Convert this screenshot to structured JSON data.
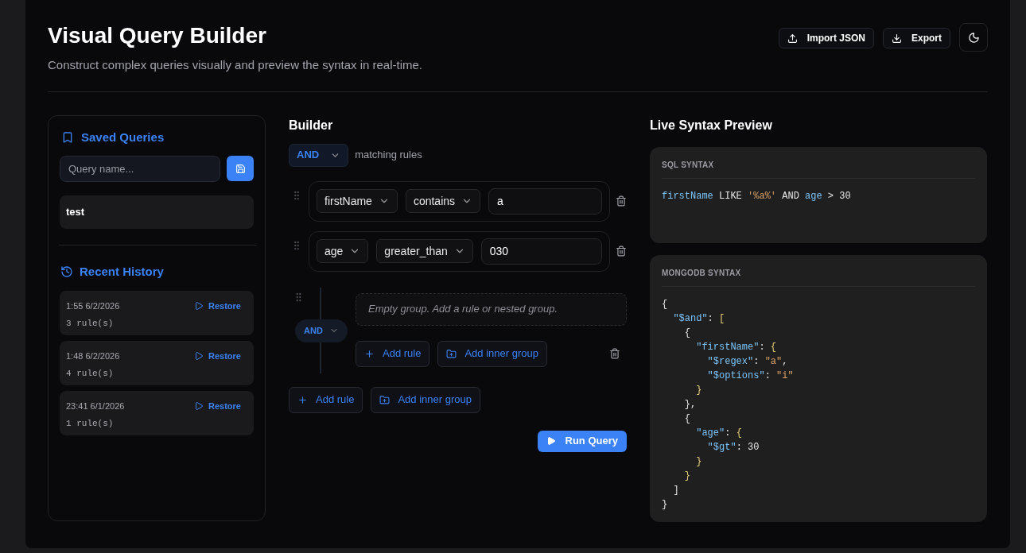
{
  "header": {
    "title": "Visual Query Builder",
    "subtitle": "Construct complex queries visually and preview the syntax in real-time.",
    "actions": [
      {
        "kind": "import",
        "label": "Import JSON"
      },
      {
        "kind": "export",
        "label": "Export"
      },
      {
        "kind": "theme"
      }
    ]
  },
  "sidebar": {
    "saved_title": "Saved Queries",
    "name_field": {
      "placeholder": "Query name..."
    },
    "saved": [
      {
        "name": "test"
      }
    ],
    "history_title": "Recent History",
    "history": [
      {
        "time": "1:55 6/2/2026",
        "rules": "3 rule(s)",
        "action": "Restore"
      },
      {
        "time": "1:48 6/2/2026",
        "rules": "4 rule(s)",
        "action": "Restore"
      },
      {
        "time": "23:41 6/1/2026",
        "rules": "1 rule(s)",
        "action": "Restore"
      }
    ]
  },
  "builder": {
    "title": "Builder",
    "combinator": "AND",
    "combinator_hint": "matching rules",
    "children": [
      {
        "kind": "rule",
        "field": "firstName",
        "operator": "contains",
        "value": "a"
      },
      {
        "kind": "rule",
        "field": "age",
        "operator": "greater_than",
        "value": "030"
      },
      {
        "kind": "group",
        "combinator": "AND",
        "empty_text": "Empty group. Add a rule or nested group.",
        "actions": [
          {
            "kind": "rule",
            "label": "Add rule"
          },
          {
            "kind": "group",
            "label": "Add inner group"
          }
        ]
      }
    ],
    "actions": [
      {
        "kind": "rule",
        "label": "Add rule"
      },
      {
        "kind": "group",
        "label": "Add inner group"
      }
    ],
    "run_label": "Run Query"
  },
  "preview": {
    "title": "Live Syntax Preview",
    "panels": [
      {
        "label": "SQL SYNTAX",
        "lines": [
          [
            {
              "kind": "field",
              "text": "firstName"
            },
            {
              "kind": "plain",
              "text": " LIKE "
            },
            {
              "kind": "string",
              "text": "'%a%'"
            },
            {
              "kind": "plain",
              "text": " AND "
            },
            {
              "kind": "field",
              "text": "age"
            },
            {
              "kind": "plain",
              "text": " > 30"
            }
          ]
        ]
      },
      {
        "label": "MONGODB SYNTAX",
        "lines": [
          [
            {
              "kind": "plain",
              "text": "{"
            }
          ],
          [
            {
              "kind": "field",
              "text": "  \"$and\""
            },
            {
              "kind": "plain",
              "text": ": "
            },
            {
              "kind": "bracket",
              "text": "["
            }
          ],
          [
            {
              "kind": "plain",
              "text": "    {"
            }
          ],
          [
            {
              "kind": "field",
              "text": "      \"firstName\""
            },
            {
              "kind": "plain",
              "text": ": "
            },
            {
              "kind": "bracket",
              "text": "{"
            }
          ],
          [
            {
              "kind": "field",
              "text": "        \"$regex\""
            },
            {
              "kind": "plain",
              "text": ": "
            },
            {
              "kind": "string",
              "text": "\"a\""
            },
            {
              "kind": "plain",
              "text": ","
            }
          ],
          [
            {
              "kind": "field",
              "text": "        \"$options\""
            },
            {
              "kind": "plain",
              "text": ": "
            },
            {
              "kind": "string",
              "text": "\"i\""
            }
          ],
          [
            {
              "kind": "bracket",
              "text": "      }"
            }
          ],
          [
            {
              "kind": "plain",
              "text": "    },"
            }
          ],
          [
            {
              "kind": "plain",
              "text": "    {"
            }
          ],
          [
            {
              "kind": "field",
              "text": "      \"age\""
            },
            {
              "kind": "plain",
              "text": ": "
            },
            {
              "kind": "bracket",
              "text": "{"
            }
          ],
          [
            {
              "kind": "field",
              "text": "        \"$gt\""
            },
            {
              "kind": "plain",
              "text": ": 30"
            }
          ],
          [
            {
              "kind": "bracket",
              "text": "      }"
            }
          ],
          [
            {
              "kind": "bracket",
              "text": "    }"
            }
          ],
          [
            {
              "kind": "plain",
              "text": "  ]"
            }
          ],
          [
            {
              "kind": "plain",
              "text": "}"
            }
          ]
        ]
      }
    ]
  }
}
